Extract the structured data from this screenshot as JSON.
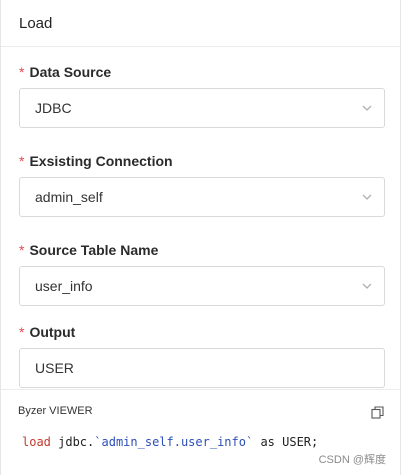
{
  "header": {
    "title": "Load"
  },
  "form": {
    "data_source": {
      "label": "Data Source",
      "required_mark": "*",
      "value": "JDBC"
    },
    "connection": {
      "label": "Exsisting Connection",
      "required_mark": "*",
      "value": "admin_self"
    },
    "source_table": {
      "label": "Source Table Name",
      "required_mark": "*",
      "value": "user_info"
    },
    "output": {
      "label": "Output",
      "required_mark": "*",
      "value": "USER"
    }
  },
  "viewer": {
    "title": "Byzer VIEWER",
    "code": {
      "kw_load": "load",
      "prefix": " jdbc.",
      "path": "`admin_self.user_info`",
      "kw_as": " as",
      "target": " USER;"
    }
  },
  "watermark": "CSDN @辉度",
  "colors": {
    "required": "#e5484d",
    "keyword": "#c0392b",
    "string": "#2c4fb8"
  },
  "icons": {
    "dropdown": "chevron-down-icon",
    "copy": "copy-icon"
  }
}
